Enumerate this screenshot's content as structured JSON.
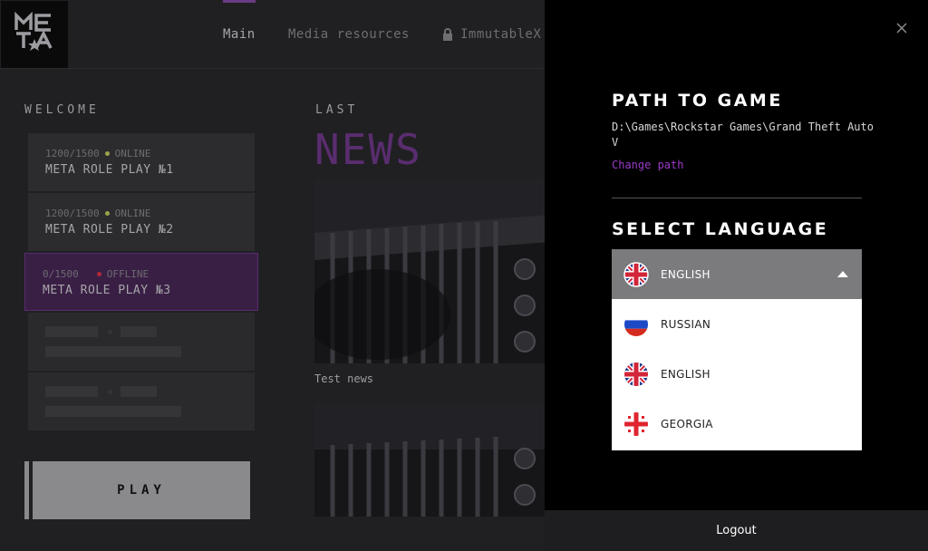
{
  "nav": {
    "main": "Main",
    "media": "Media resources",
    "immutable": "ImmutableX"
  },
  "welcome": {
    "title": "WELCOME",
    "servers": [
      {
        "count": "1200/1500",
        "status": "ONLINE",
        "status_color": "#9aa34a",
        "name": "META ROLE PLAY №1"
      },
      {
        "count": "1200/1500",
        "status": "ONLINE",
        "status_color": "#9aa34a",
        "name": "META ROLE PLAY №2"
      },
      {
        "count": "0/1500",
        "status": "OFFLINE",
        "status_color": "#b22a3a",
        "name": "META ROLE PLAY №3"
      }
    ],
    "play_label": "PLAY"
  },
  "news": {
    "last": "LAST",
    "title": "NEWS",
    "caption": "Test news"
  },
  "settings": {
    "path_title": "PATH TO GAME",
    "path_value": "D:\\Games\\Rockstar Games\\Grand Theft Auto V",
    "change_path": "Change path",
    "lang_title": "SELECT LANGUAGE",
    "selected_language": "ENGLISH",
    "languages": [
      "RUSSIAN",
      "ENGLISH",
      "GEORGIA"
    ],
    "logout": "Logout"
  },
  "colors": {
    "accent": "#9a3cc6",
    "active_card": "#3a1f45",
    "panel": "#000000"
  }
}
